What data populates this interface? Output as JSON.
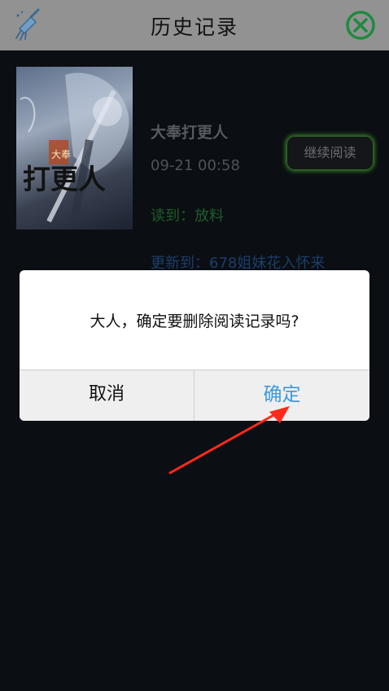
{
  "header": {
    "title": "历史记录",
    "left_icon": "broom-clean-icon",
    "right_icon": "close-circle-icon",
    "close_color": "#1e8a3e"
  },
  "history": {
    "items": [
      {
        "cover_text": "打更人",
        "cover_badge": "大奉",
        "name": "大奉打更人",
        "time": "09-21 00:58",
        "read_to": "读到：放料",
        "updated_to": "更新到：678姐妹花入怀来",
        "continue_label": "继续阅读"
      }
    ]
  },
  "dialog": {
    "message": "大人，确定要删除阅读记录吗?",
    "cancel_label": "取消",
    "confirm_label": "确定",
    "confirm_color": "#3b99e0"
  },
  "annotation": {
    "arrow_color": "#ff2a1a"
  }
}
